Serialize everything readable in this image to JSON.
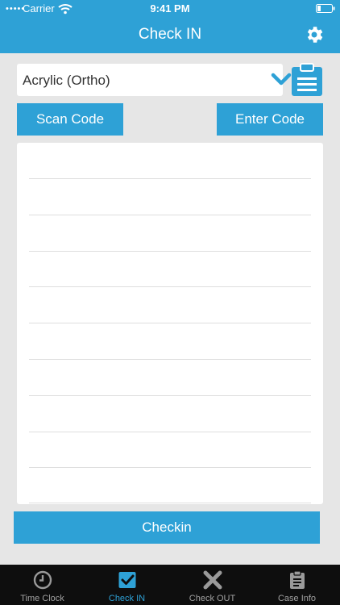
{
  "status_bar": {
    "signal": "•••••",
    "carrier": "Carrier",
    "time": "9:41 PM"
  },
  "nav": {
    "title": "Check IN"
  },
  "material_select": {
    "value": "Acrylic (Ortho)"
  },
  "buttons": {
    "scan": "Scan Code",
    "enter": "Enter Code",
    "checkin": "Checkin"
  },
  "tabs": [
    {
      "label": "Time Clock",
      "icon": "clock-icon"
    },
    {
      "label": "Check IN",
      "icon": "checkbox-icon"
    },
    {
      "label": "Check OUT",
      "icon": "x-icon"
    },
    {
      "label": "Case Info",
      "icon": "clipboard-icon"
    }
  ],
  "colors": {
    "accent": "#2ea1d6",
    "tabbar": "#0e0e0e",
    "background": "#e6e6e6"
  }
}
